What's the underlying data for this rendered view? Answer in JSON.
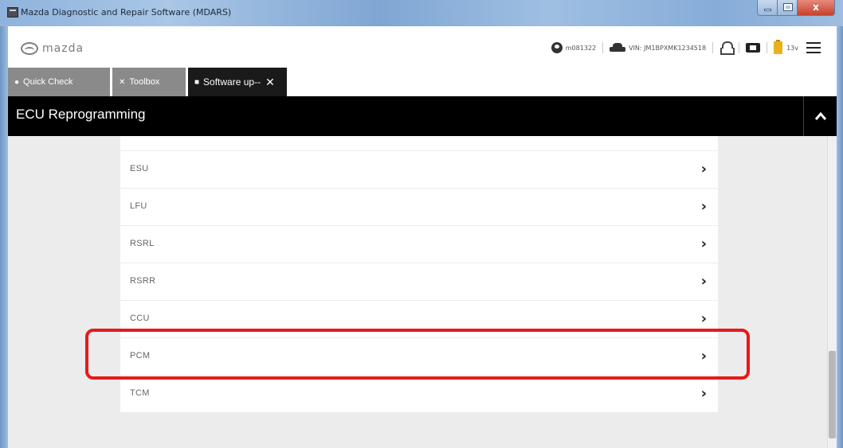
{
  "window": {
    "title": "Mazda Diagnostic and Repair Software (MDARS)",
    "close_label": "x"
  },
  "header": {
    "logo_text": "mazda",
    "user_id": "m081322",
    "vin": "VIN: JM1BPXMK1234518",
    "voltage": "13v"
  },
  "tabs": [
    {
      "label": "Quick Check",
      "icon": "car-icon"
    },
    {
      "label": "Toolbox",
      "icon": "tools-icon"
    },
    {
      "label": "Software up--",
      "icon": "chip-icon",
      "active": true,
      "close": "✕"
    }
  ],
  "section": {
    "title": "ECU Reprogramming",
    "collapse_glyph": "^"
  },
  "modules": [
    {
      "label": ""
    },
    {
      "label": "ESU"
    },
    {
      "label": "LFU"
    },
    {
      "label": "RSRL"
    },
    {
      "label": "RSRR"
    },
    {
      "label": "CCU"
    },
    {
      "label": "PCM",
      "highlighted": true
    },
    {
      "label": "TCM"
    }
  ],
  "chevron": "›",
  "colors": {
    "highlight": "#e61a1a",
    "section_bg": "#000000",
    "tab_inactive": "#8a8a8a",
    "tab_active": "#1a1a1a"
  }
}
